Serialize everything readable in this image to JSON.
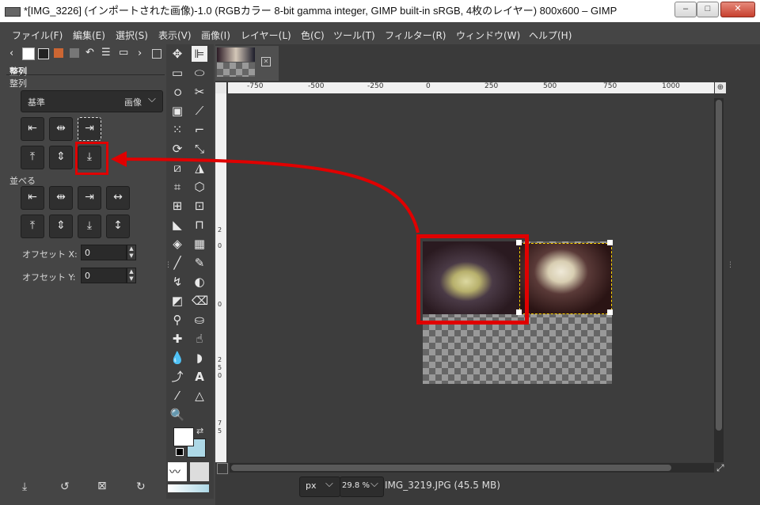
{
  "window": {
    "title": "*[IMG_3226] (インポートされた画像)-1.0 (RGBカラー 8-bit gamma integer, GIMP built-in sRGB, 4枚のレイヤー) 800x600 – GIMP",
    "minimize": "–",
    "maximize": "□",
    "close": "✕"
  },
  "menu": [
    "ファイル(F)",
    "編集(E)",
    "選択(S)",
    "表示(V)",
    "画像(I)",
    "レイヤー(L)",
    "色(C)",
    "ツール(T)",
    "フィルター(R)",
    "ウィンドウ(W)",
    "ヘルプ(H)"
  ],
  "dock": {
    "panel_title": "整列",
    "section_align": "整列",
    "relative_label": "基準",
    "relative_value": "画像",
    "section_distribute": "並べる",
    "offset_x_label": "オフセット X:",
    "offset_x_value": "0",
    "offset_y_label": "オフセット Y:",
    "offset_y_value": "0"
  },
  "status": {
    "unit": "px",
    "zoom": "29.8 %",
    "file_info": "IMG_3219.JPG (45.5 MB)"
  },
  "ruler": {
    "h_labels": [
      "-750",
      "-500",
      "-250",
      "0",
      "250",
      "500",
      "750",
      "1000"
    ],
    "v_labels": [
      "2",
      "0",
      "0",
      "2",
      "5",
      "0",
      "7",
      "5"
    ]
  },
  "colors": {
    "highlight": "#e00000",
    "panel_bg": "#454545",
    "canvas_bg": "#3a3a3a"
  }
}
